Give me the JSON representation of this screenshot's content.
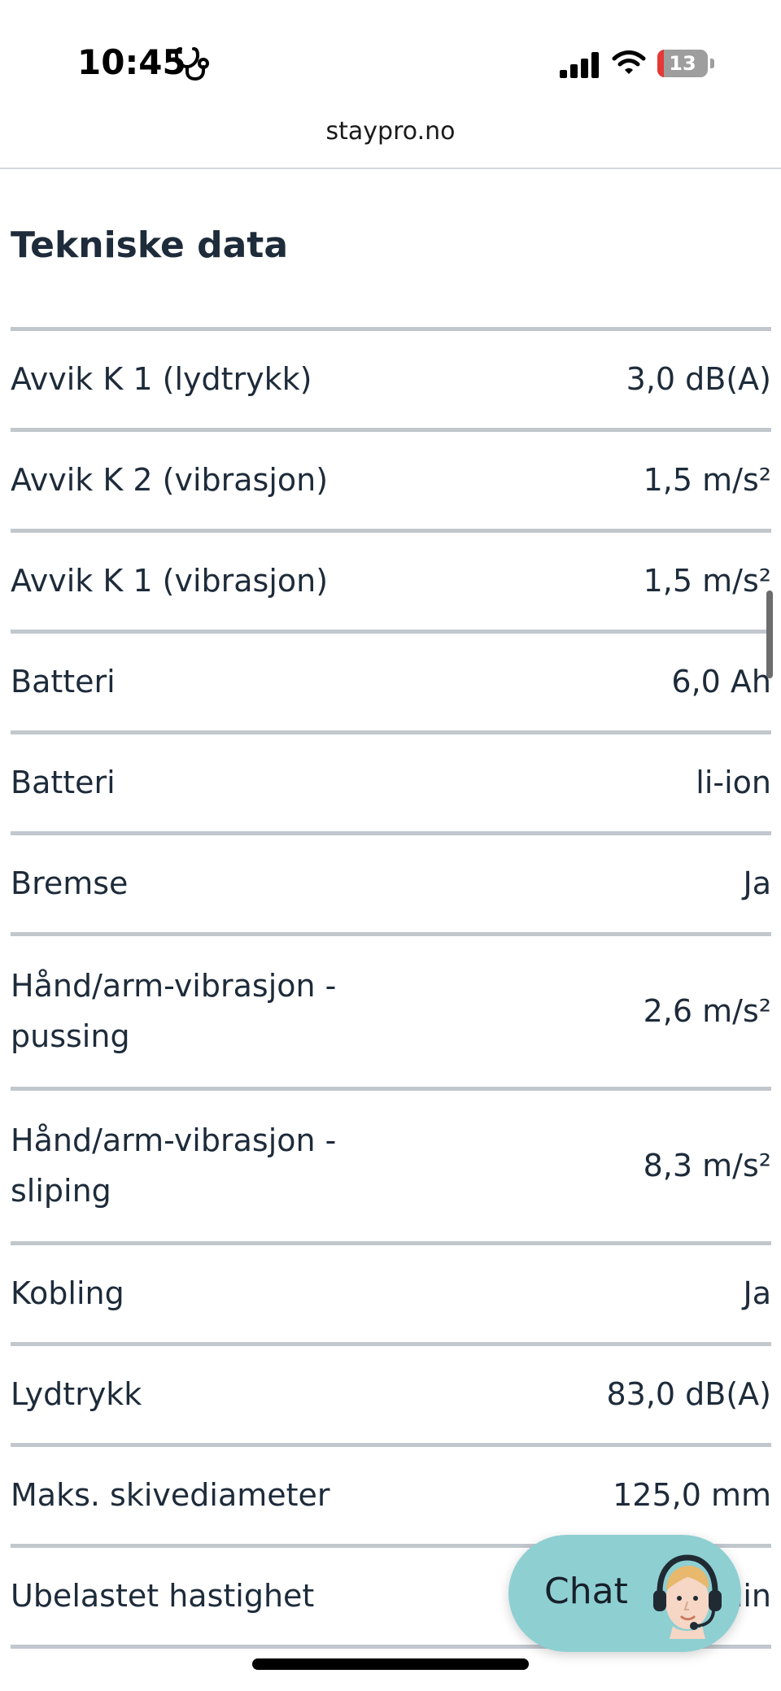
{
  "status_bar": {
    "time": "10:45",
    "battery_level": "13",
    "battery_fraction": 0.13,
    "battery_low_color": "#e53935",
    "icons": [
      "stethoscope-icon",
      "cellular-signal-icon",
      "wifi-icon",
      "battery-icon"
    ]
  },
  "browser": {
    "url": "staypro.no"
  },
  "section": {
    "title": "Tekniske data"
  },
  "specs": [
    {
      "label": "Avvik K 1 (lydtrykk)",
      "value": "3,0 dB(A)"
    },
    {
      "label": "Avvik K 2 (vibrasjon)",
      "value": "1,5 m/s²"
    },
    {
      "label": "Avvik K 1 (vibrasjon)",
      "value": "1,5 m/s²"
    },
    {
      "label": "Batteri",
      "value": "6,0 Ah"
    },
    {
      "label": "Batteri",
      "value": "li-ion"
    },
    {
      "label": "Bremse",
      "value": "Ja"
    },
    {
      "label": "Hånd/arm-vibrasjon - pussing",
      "value": "2,6 m/s²"
    },
    {
      "label": "Hånd/arm-vibrasjon - sliping",
      "value": "8,3 m/s²"
    },
    {
      "label": "Kobling",
      "value": "Ja"
    },
    {
      "label": "Lydtrykk",
      "value": "83,0 dB(A)"
    },
    {
      "label": "Maks. skivediameter",
      "value": "125,0 mm"
    },
    {
      "label": "Ubelastet hastighet",
      "value": "/min"
    }
  ],
  "chat": {
    "label": "Chat",
    "avatar_icon": "support-agent-avatar",
    "color": "#8ecfd2"
  },
  "colors": {
    "text": "#1d2b3a",
    "divider": "#c1c7cd"
  }
}
